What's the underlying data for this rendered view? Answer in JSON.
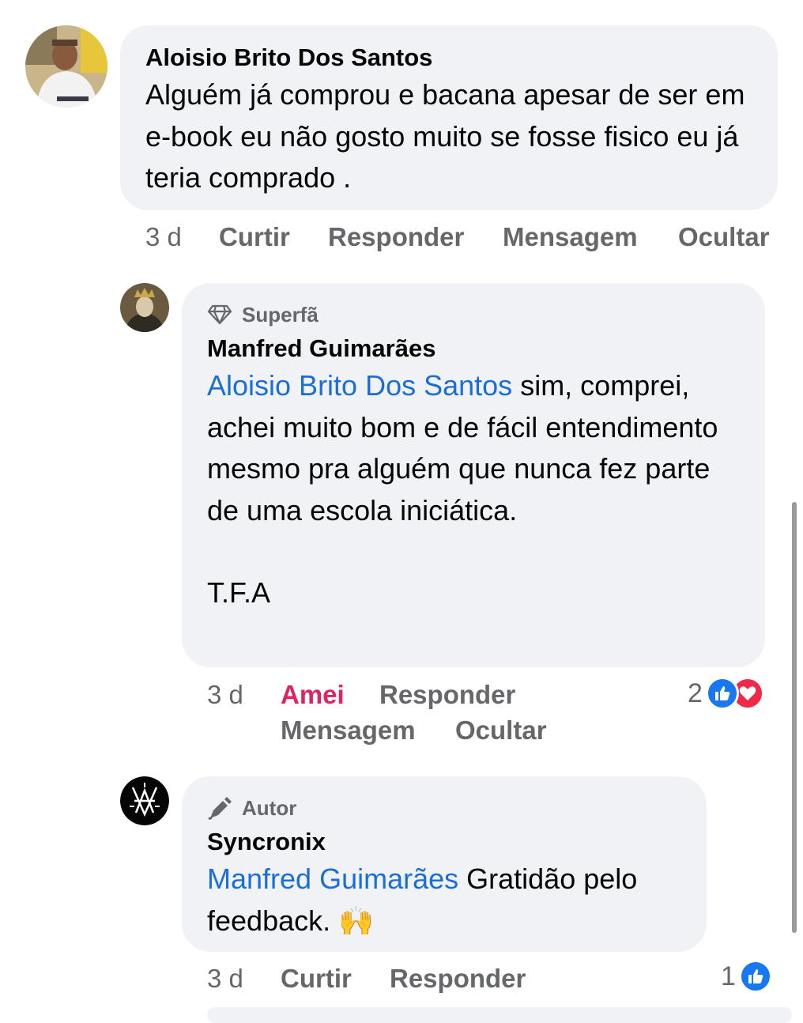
{
  "comments": [
    {
      "author": "Aloisio Brito Dos Santos",
      "text": "Alguém já comprou e bacana apesar de ser em e-book eu não gosto muito se fosse fisico eu já teria comprado .",
      "time": "3 d",
      "actions": [
        "Curtir",
        "Responder",
        "Mensagem",
        "Ocultar"
      ]
    },
    {
      "badge": "Superfã",
      "author": "Manfred Guimarães",
      "mention": "Aloisio Brito Dos Santos",
      "text": " sim, comprei, achei muito bom e de fácil entendimento mesmo pra alguém que nunca fez parte de uma escola iniciática.",
      "signature": "T.F.A",
      "time": "3 d",
      "actions": [
        "Amei",
        "Responder",
        "Mensagem",
        "Ocultar"
      ],
      "reaction_count": "2",
      "reactions": [
        "like-icon",
        "love-icon"
      ]
    },
    {
      "badge": "Autor",
      "author": "Syncronix",
      "mention": "Manfred Guimarães",
      "text": " Gratidão pelo feedback. 🙌",
      "time": "3 d",
      "actions": [
        "Curtir",
        "Responder"
      ],
      "reaction_count": "1",
      "reactions": [
        "like-icon"
      ]
    }
  ],
  "colors": {
    "mention": "#1a6ed8",
    "amei": "#e0245e",
    "bubble": "#f0f2f5",
    "meta": "#65676b"
  }
}
